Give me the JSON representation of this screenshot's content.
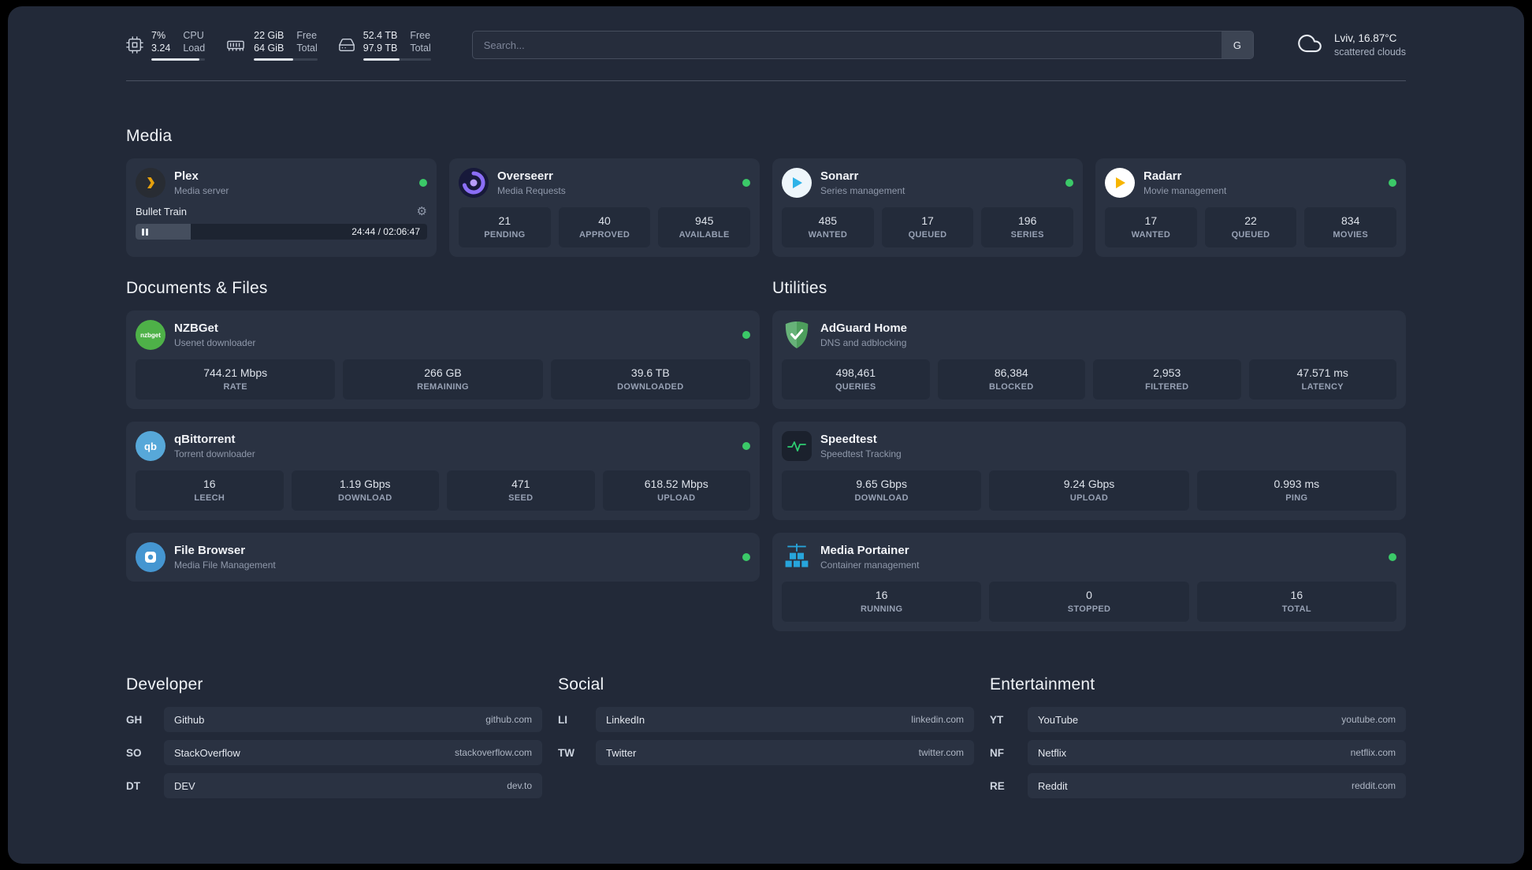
{
  "colors": {
    "status_green": "#3bc968",
    "background": "#222938",
    "card": "#2a3242"
  },
  "topbar": {
    "cpu": {
      "value": "7%",
      "sub": "3.24",
      "label_top": "CPU",
      "label_bottom": "Load"
    },
    "ram": {
      "value": "22 GiB",
      "sub": "64 GiB",
      "label_top": "Free",
      "label_bottom": "Total"
    },
    "disk": {
      "value": "52.4 TB",
      "sub": "97.9 TB",
      "label_top": "Free",
      "label_bottom": "Total"
    },
    "search": {
      "placeholder": "Search...",
      "button_label": "G"
    },
    "weather": {
      "location": "Lviv, 16.87°C",
      "condition": "scattered clouds"
    }
  },
  "media": {
    "title": "Media",
    "plex": {
      "name": "Plex",
      "subtitle": "Media server",
      "now_playing": "Bullet Train",
      "time": "24:44 / 02:06:47"
    },
    "overseerr": {
      "name": "Overseerr",
      "subtitle": "Media Requests",
      "stats": [
        {
          "value": "21",
          "label": "PENDING"
        },
        {
          "value": "40",
          "label": "APPROVED"
        },
        {
          "value": "945",
          "label": "AVAILABLE"
        }
      ]
    },
    "sonarr": {
      "name": "Sonarr",
      "subtitle": "Series management",
      "stats": [
        {
          "value": "485",
          "label": "WANTED"
        },
        {
          "value": "17",
          "label": "QUEUED"
        },
        {
          "value": "196",
          "label": "SERIES"
        }
      ]
    },
    "radarr": {
      "name": "Radarr",
      "subtitle": "Movie management",
      "stats": [
        {
          "value": "17",
          "label": "WANTED"
        },
        {
          "value": "22",
          "label": "QUEUED"
        },
        {
          "value": "834",
          "label": "MOVIES"
        }
      ]
    }
  },
  "documents": {
    "title": "Documents & Files",
    "nzbget": {
      "name": "NZBGet",
      "subtitle": "Usenet downloader",
      "stats": [
        {
          "value": "744.21 Mbps",
          "label": "RATE"
        },
        {
          "value": "266 GB",
          "label": "REMAINING"
        },
        {
          "value": "39.6 TB",
          "label": "DOWNLOADED"
        }
      ]
    },
    "qbittorrent": {
      "name": "qBittorrent",
      "subtitle": "Torrent downloader",
      "stats": [
        {
          "value": "16",
          "label": "LEECH"
        },
        {
          "value": "1.19 Gbps",
          "label": "DOWNLOAD"
        },
        {
          "value": "471",
          "label": "SEED"
        },
        {
          "value": "618.52 Mbps",
          "label": "UPLOAD"
        }
      ]
    },
    "filebrowser": {
      "name": "File Browser",
      "subtitle": "Media File Management"
    }
  },
  "utilities": {
    "title": "Utilities",
    "adguard": {
      "name": "AdGuard Home",
      "subtitle": "DNS and adblocking",
      "stats": [
        {
          "value": "498,461",
          "label": "QUERIES"
        },
        {
          "value": "86,384",
          "label": "BLOCKED"
        },
        {
          "value": "2,953",
          "label": "FILTERED"
        },
        {
          "value": "47.571 ms",
          "label": "LATENCY"
        }
      ]
    },
    "speedtest": {
      "name": "Speedtest",
      "subtitle": "Speedtest Tracking",
      "stats": [
        {
          "value": "9.65 Gbps",
          "label": "DOWNLOAD"
        },
        {
          "value": "9.24 Gbps",
          "label": "UPLOAD"
        },
        {
          "value": "0.993 ms",
          "label": "PING"
        }
      ]
    },
    "portainer": {
      "name": "Media Portainer",
      "subtitle": "Container management",
      "stats": [
        {
          "value": "16",
          "label": "RUNNING"
        },
        {
          "value": "0",
          "label": "STOPPED"
        },
        {
          "value": "16",
          "label": "TOTAL"
        }
      ]
    }
  },
  "developer": {
    "title": "Developer",
    "links": [
      {
        "abbr": "GH",
        "name": "Github",
        "url": "github.com"
      },
      {
        "abbr": "SO",
        "name": "StackOverflow",
        "url": "stackoverflow.com"
      },
      {
        "abbr": "DT",
        "name": "DEV",
        "url": "dev.to"
      }
    ]
  },
  "social": {
    "title": "Social",
    "links": [
      {
        "abbr": "LI",
        "name": "LinkedIn",
        "url": "linkedin.com"
      },
      {
        "abbr": "TW",
        "name": "Twitter",
        "url": "twitter.com"
      }
    ]
  },
  "entertainment": {
    "title": "Entertainment",
    "links": [
      {
        "abbr": "YT",
        "name": "YouTube",
        "url": "youtube.com"
      },
      {
        "abbr": "NF",
        "name": "Netflix",
        "url": "netflix.com"
      },
      {
        "abbr": "RE",
        "name": "Reddit",
        "url": "reddit.com"
      }
    ]
  }
}
